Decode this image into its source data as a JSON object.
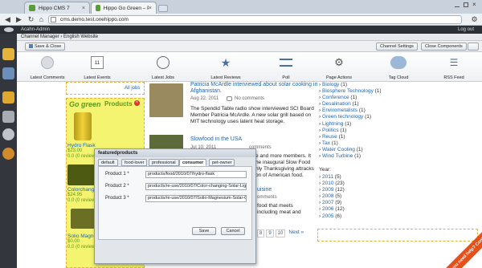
{
  "browser": {
    "tabs": [
      {
        "label": "Hippo CMS 7"
      },
      {
        "label": "Hippo Go Green – Products"
      }
    ],
    "url": "cms.demo.test.onehippo.com"
  },
  "app": {
    "user": "Acahn-Admin",
    "logout": "Log out",
    "breadcrumb": "Channel Manager › English Website",
    "save_close": "Save & Close",
    "channel_settings": "Channel Settings",
    "close_components": "Close Components"
  },
  "iconbar": [
    {
      "label": "Latest Comments",
      "icon": "comment-icon"
    },
    {
      "label": "Latest Events",
      "icon": "calendar-icon"
    },
    {
      "label": "Latest Jobs",
      "icon": "clock-icon"
    },
    {
      "label": "Latest Reviews",
      "icon": "star-icon"
    },
    {
      "label": "Poll",
      "icon": "list-icon"
    },
    {
      "label": "Page Actions",
      "icon": "gear-icon"
    },
    {
      "label": "Tag Cloud",
      "icon": "cloud-icon"
    },
    {
      "label": "RSS Feed",
      "icon": "rss-icon"
    }
  ],
  "content": {
    "all_jobs": "All jobs",
    "gogreen_logo": "Go green",
    "gogreen_products": "Products",
    "products": [
      {
        "name": "Hydro Flask",
        "price": "$23.00",
        "rating": "0.0 (0 review)"
      },
      {
        "name": "Colorchange",
        "price": "$24.95",
        "rating": "0.0 (0 review)"
      },
      {
        "name": "Solio Magne",
        "price": "$0.00",
        "rating": "0.0 (0 review)"
      }
    ],
    "article1": {
      "title": "Patricia McArdle interviewed about solar cooking in Afghanistan.",
      "date": "Aug 22, 2011",
      "comments": "No comments",
      "body": "The Spendid Table radio show interviewed SCI Board Member Patricia McArdle. A new solar grill based on MIT technology uses latent heat storage."
    },
    "article2": {
      "title": "Slowfood in the USA",
      "date": "Jul 10, 2011",
      "comments": "comments"
    },
    "article2_text": [
      "e and more members. It",
      "he inaugural Slow Food",
      "nly Thanksgiving attracks",
      "on of American food."
    ],
    "article3": {
      "title": "uisine",
      "comments": "omments",
      "text": [
        "food that meets",
        "including meat and"
      ]
    },
    "pager": {
      "pages": [
        "8",
        "9",
        "10"
      ],
      "next": "Next »"
    }
  },
  "right_col": {
    "categories": [
      {
        "label": "Biology",
        "count": "(1)"
      },
      {
        "label": "Biosphere Technology",
        "count": "(1)"
      },
      {
        "label": "Conference",
        "count": "(1)"
      },
      {
        "label": "Desalination",
        "count": "(1)"
      },
      {
        "label": "Envirometalists",
        "count": "(1)"
      },
      {
        "label": "Green technology",
        "count": "(1)"
      },
      {
        "label": "Lightning",
        "count": "(1)"
      },
      {
        "label": "Politics",
        "count": "(1)"
      },
      {
        "label": "Reuse",
        "count": "(1)"
      },
      {
        "label": "Tax",
        "count": "(1)"
      },
      {
        "label": "Water Cooling",
        "count": "(1)"
      },
      {
        "label": "Wind Turbine",
        "count": "(1)"
      }
    ],
    "year_label": "Year:",
    "years": [
      {
        "label": "2011",
        "count": "(5)"
      },
      {
        "label": "2010",
        "count": "(23)"
      },
      {
        "label": "2009",
        "count": "(12)"
      },
      {
        "label": "2008",
        "count": "(5)"
      },
      {
        "label": "2007",
        "count": "(9)"
      },
      {
        "label": "2006",
        "count": "(12)"
      },
      {
        "label": "2005",
        "count": "(6)"
      }
    ]
  },
  "dialog": {
    "title": "featuredproducts",
    "tabs": [
      "default",
      "food-lover",
      "professional",
      "consumer",
      "pet-owner"
    ],
    "active_tab": "consumer",
    "fields": [
      {
        "label": "Product 1 *",
        "value": "products/food/2010/07/hydro-flask"
      },
      {
        "label": "Product 2 *",
        "value": "products/re-use/2010/07/Color-changing-Solar-Lig"
      },
      {
        "label": "Product 3 *",
        "value": "products/re-use/2010/07/Solio-Magnesium-Solar-C"
      }
    ],
    "save": "Save",
    "cancel": "Cancel"
  },
  "contact_badge": "Do you need help? Contact us"
}
